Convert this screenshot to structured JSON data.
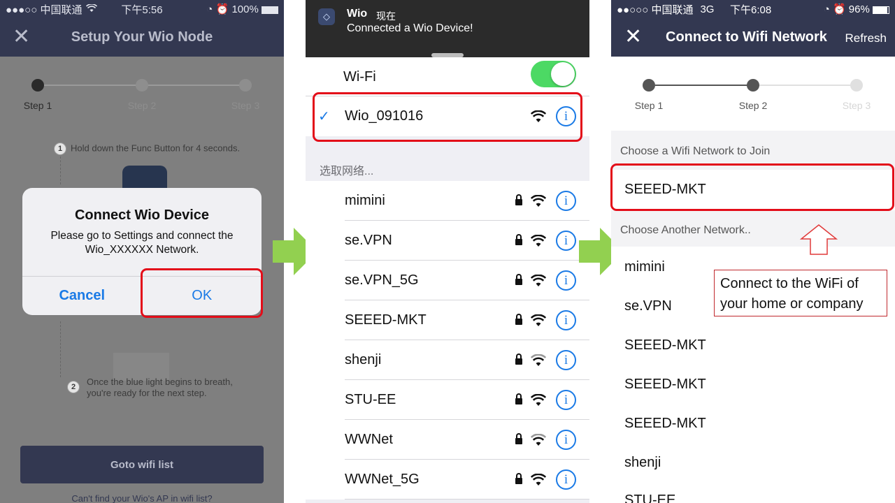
{
  "panel1": {
    "status": {
      "carrier": "●●●○○ 中国联通",
      "time": "下午5:56",
      "battery": "100%"
    },
    "nav_title": "Setup Your Wio Node",
    "steps": [
      "Step 1",
      "Step 2",
      "Step 3"
    ],
    "instruction1": "Hold down the Func Button for 4 seconds.",
    "instruction2_line1": "Once the blue light begins to breath,",
    "instruction2_line2": "you're ready for the next step.",
    "dialog": {
      "title": "Connect Wio Device",
      "message_line1": "Please go to Settings and connect the",
      "message_line2": "Wio_XXXXXX Network.",
      "cancel": "Cancel",
      "ok": "OK"
    },
    "goto_button": "Goto wifi list",
    "cant_find": "Can't find your Wio's AP in wifi list?"
  },
  "panel2": {
    "notification": {
      "app": "Wio",
      "time": "现在",
      "message": "Connected a Wio Device!"
    },
    "wifi_label": "Wi-Fi",
    "connected_network": "Wio_091016",
    "choose_header": "选取网络...",
    "networks": [
      "mimini",
      "se.VPN",
      "se.VPN_5G",
      "SEEED-MKT",
      "shenji",
      "STU-EE",
      "WWNet",
      "WWNet_5G"
    ]
  },
  "panel3": {
    "status": {
      "carrier": "●●○○○ 中国联通",
      "network": "3G",
      "time": "下午6:08",
      "battery": "96%"
    },
    "nav_title": "Connect to Wifi Network",
    "refresh": "Refresh",
    "steps": [
      "Step 1",
      "Step 2",
      "Step 3"
    ],
    "choose_header": "Choose a Wifi Network to Join",
    "selected_network": "SEEED-MKT",
    "another_header": "Choose Another Network..",
    "networks": [
      "mimini",
      "se.VPN",
      "SEEED-MKT",
      "SEEED-MKT",
      "SEEED-MKT",
      "shenji",
      "STU-EE"
    ]
  },
  "callout": {
    "line1": "Connect to the WiFi of",
    "line2": "your home or company"
  },
  "colors": {
    "highlight_red": "#e30d19",
    "arrow_green": "#92d050",
    "nav_blue": "#333851",
    "ios_blue": "#1a7ae6",
    "toggle_green": "#4cd964"
  }
}
